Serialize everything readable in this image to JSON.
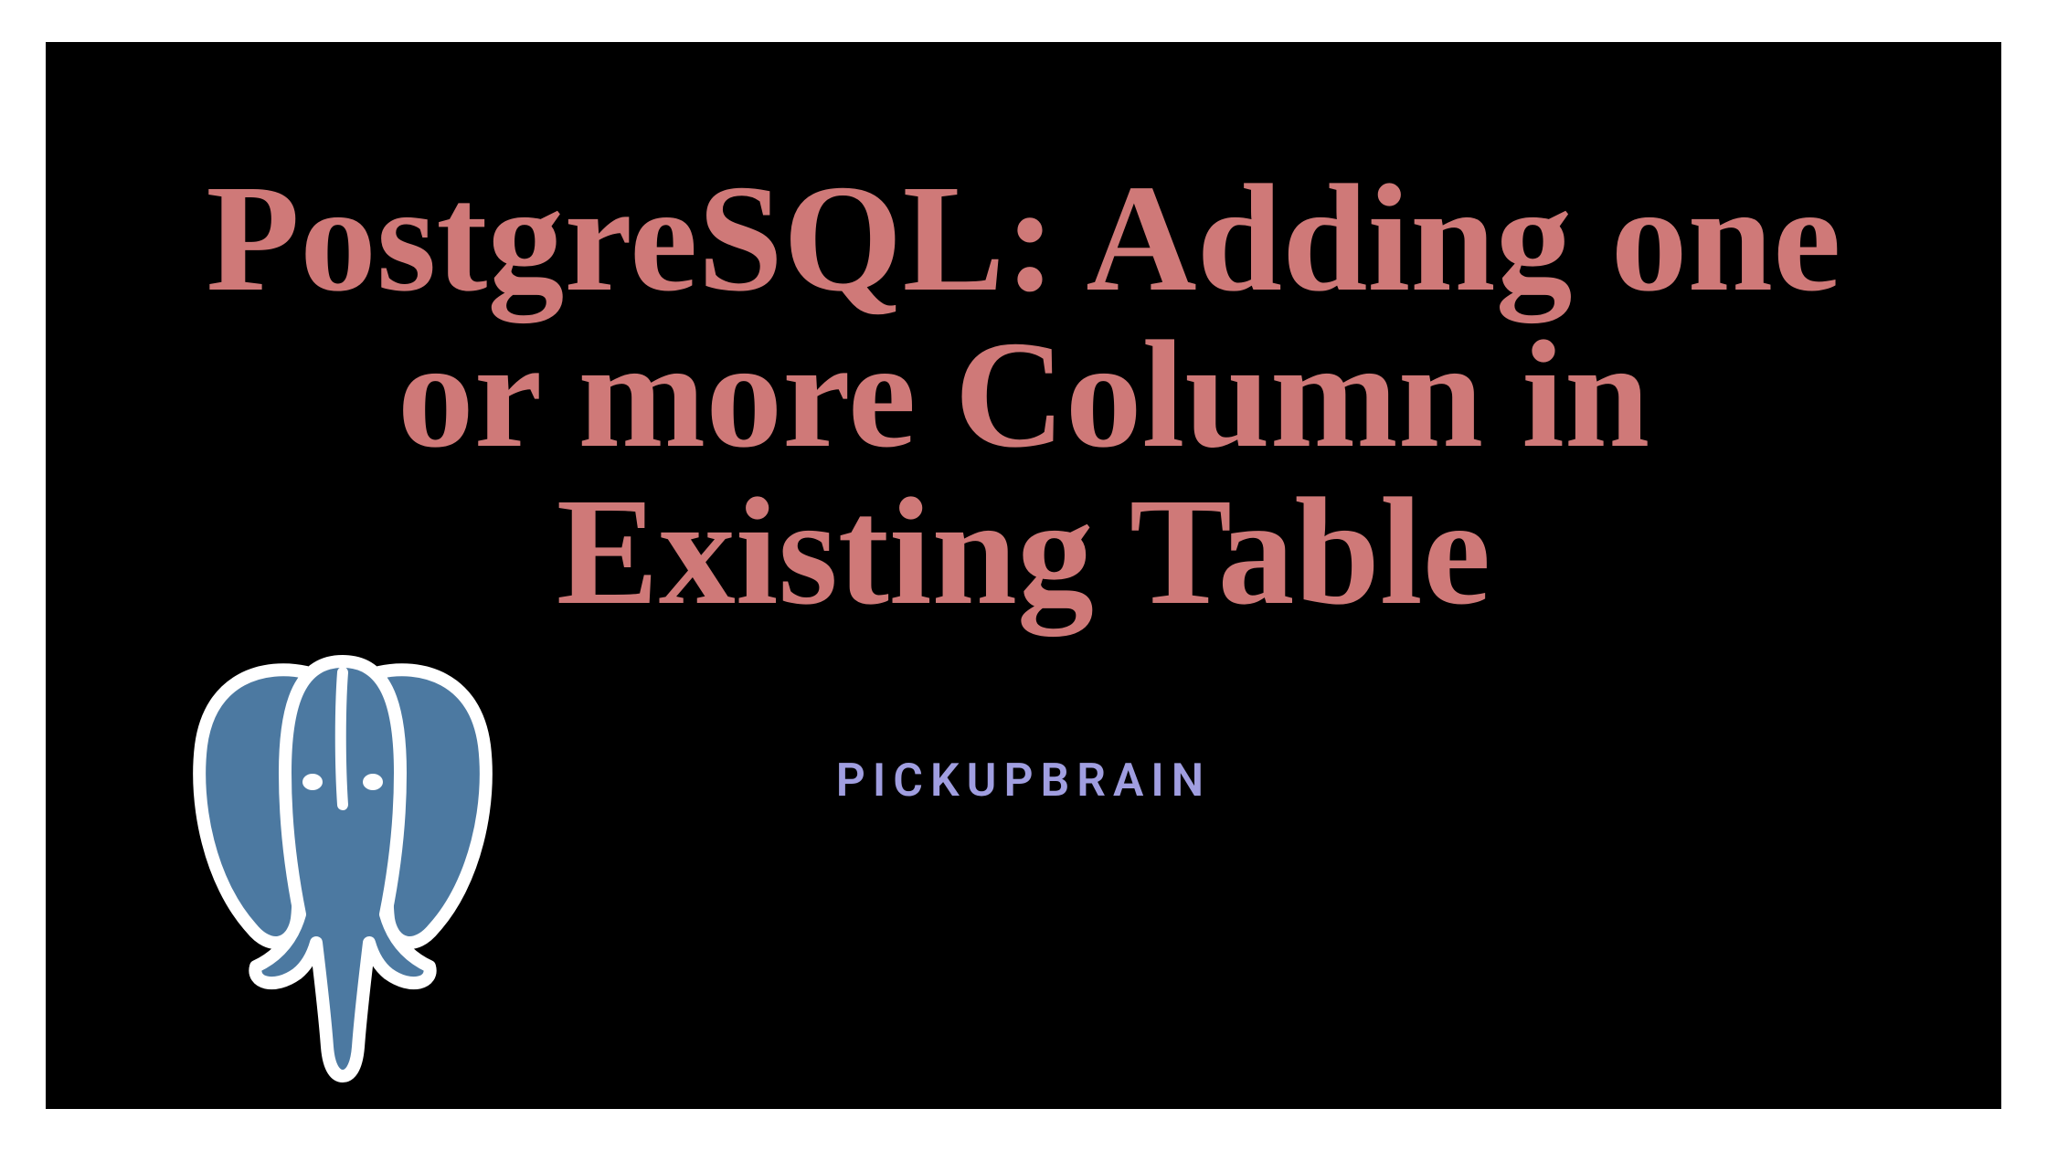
{
  "title": "PostgreSQL: Adding one or more Column in Existing Table",
  "brand": "PICKUPBRAIN",
  "colors": {
    "background": "#000000",
    "title": "#cf7978",
    "brand": "#a09ee0",
    "logo_fill": "#4c79a1",
    "logo_stroke": "#ffffff"
  }
}
